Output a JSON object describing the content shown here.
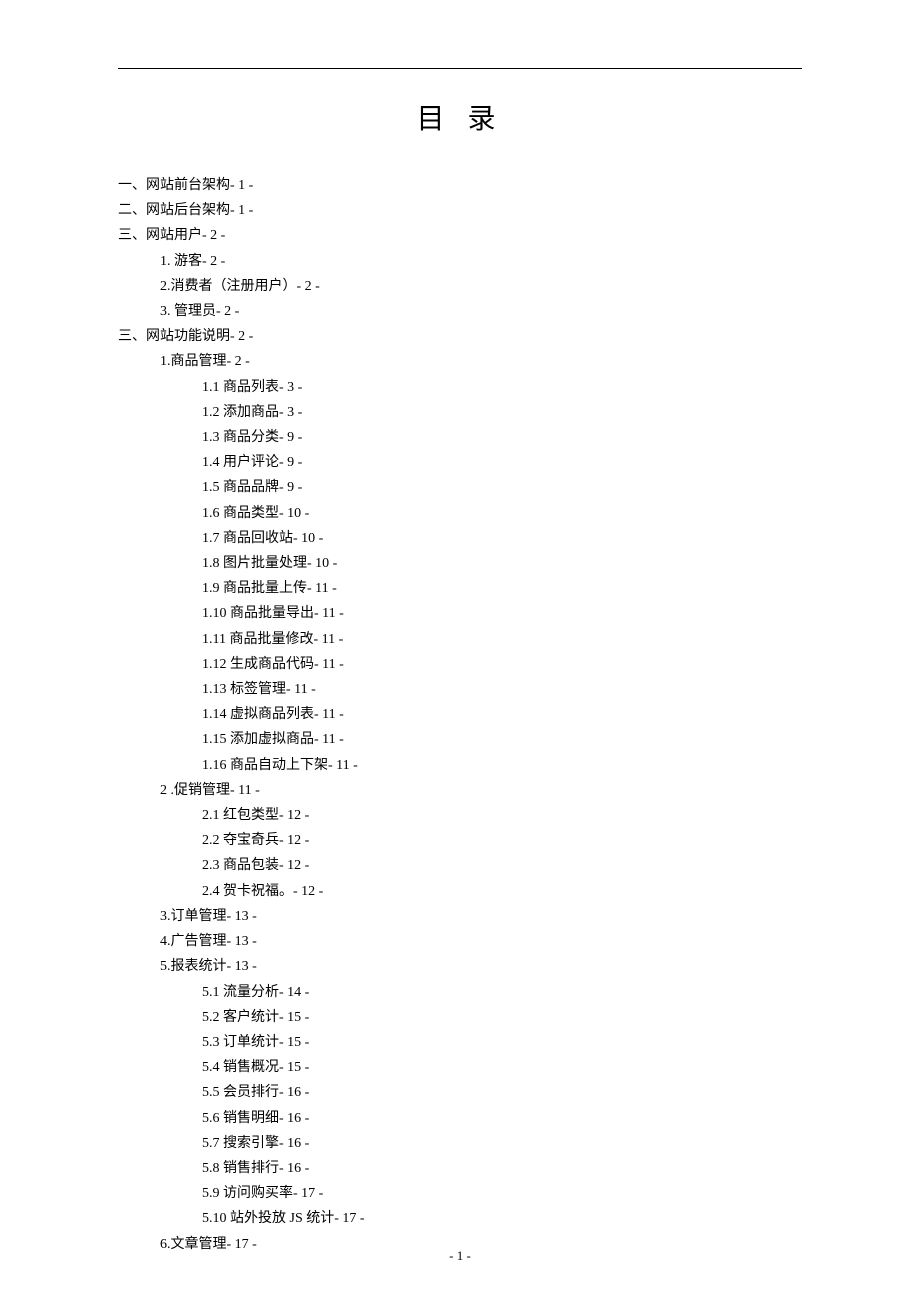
{
  "title": "目 录",
  "page_footer": "- 1 -",
  "toc": [
    {
      "level": 0,
      "text": "一、网站前台架构- 1 -"
    },
    {
      "level": 0,
      "text": "二、网站后台架构- 1 -"
    },
    {
      "level": 0,
      "text": "三、网站用户- 2 -"
    },
    {
      "level": 1,
      "text": "1. 游客- 2 -"
    },
    {
      "level": 1,
      "text": "2.消费者（注册用户）- 2 -"
    },
    {
      "level": 1,
      "text": "3. 管理员- 2 -"
    },
    {
      "level": 0,
      "text": "三、网站功能说明- 2 -"
    },
    {
      "level": 1,
      "text": "1.商品管理- 2 -"
    },
    {
      "level": 2,
      "text": "1.1 商品列表- 3 -"
    },
    {
      "level": 2,
      "text": "1.2 添加商品- 3 -"
    },
    {
      "level": 2,
      "text": "1.3 商品分类- 9 -"
    },
    {
      "level": 2,
      "text": "1.4 用户评论- 9 -"
    },
    {
      "level": 2,
      "text": "1.5 商品品牌- 9 -"
    },
    {
      "level": 2,
      "text": "1.6 商品类型- 10 -"
    },
    {
      "level": 2,
      "text": "1.7 商品回收站- 10 -"
    },
    {
      "level": 2,
      "text": "1.8 图片批量处理- 10 -"
    },
    {
      "level": 2,
      "text": "1.9 商品批量上传- 11 -"
    },
    {
      "level": 2,
      "text": "1.10 商品批量导出- 11 -"
    },
    {
      "level": 2,
      "text": "1.11 商品批量修改- 11 -"
    },
    {
      "level": 2,
      "text": "1.12 生成商品代码- 11 -"
    },
    {
      "level": 2,
      "text": "1.13 标签管理- 11 -"
    },
    {
      "level": 2,
      "text": "1.14 虚拟商品列表- 11 -"
    },
    {
      "level": 2,
      "text": "1.15 添加虚拟商品- 11 -"
    },
    {
      "level": 2,
      "text": "1.16 商品自动上下架- 11 -"
    },
    {
      "level": 1,
      "text": "2 .促销管理- 11 -"
    },
    {
      "level": 2,
      "text": "2.1 红包类型- 12 -"
    },
    {
      "level": 2,
      "text": "2.2 夺宝奇兵- 12 -"
    },
    {
      "level": 2,
      "text": "2.3 商品包装- 12 -"
    },
    {
      "level": 2,
      "text": "2.4 贺卡祝福。- 12 -"
    },
    {
      "level": 1,
      "text": "3.订单管理- 13 -"
    },
    {
      "level": 1,
      "text": "4.广告管理- 13 -"
    },
    {
      "level": 1,
      "text": "5.报表统计- 13 -"
    },
    {
      "level": 2,
      "text": "5.1 流量分析- 14 -"
    },
    {
      "level": 2,
      "text": "5.2 客户统计- 15 -"
    },
    {
      "level": 2,
      "text": "5.3 订单统计- 15 -"
    },
    {
      "level": 2,
      "text": "5.4 销售概况- 15 -"
    },
    {
      "level": 2,
      "text": "5.5 会员排行- 16 -"
    },
    {
      "level": 2,
      "text": "5.6 销售明细- 16 -"
    },
    {
      "level": 2,
      "text": "5.7 搜索引擎- 16 -"
    },
    {
      "level": 2,
      "text": "5.8 销售排行- 16 -"
    },
    {
      "level": 2,
      "text": "5.9 访问购买率- 17 -"
    },
    {
      "level": 2,
      "text": "5.10 站外投放 JS 统计- 17 -"
    },
    {
      "level": 1,
      "text": "6.文章管理- 17 -"
    }
  ]
}
